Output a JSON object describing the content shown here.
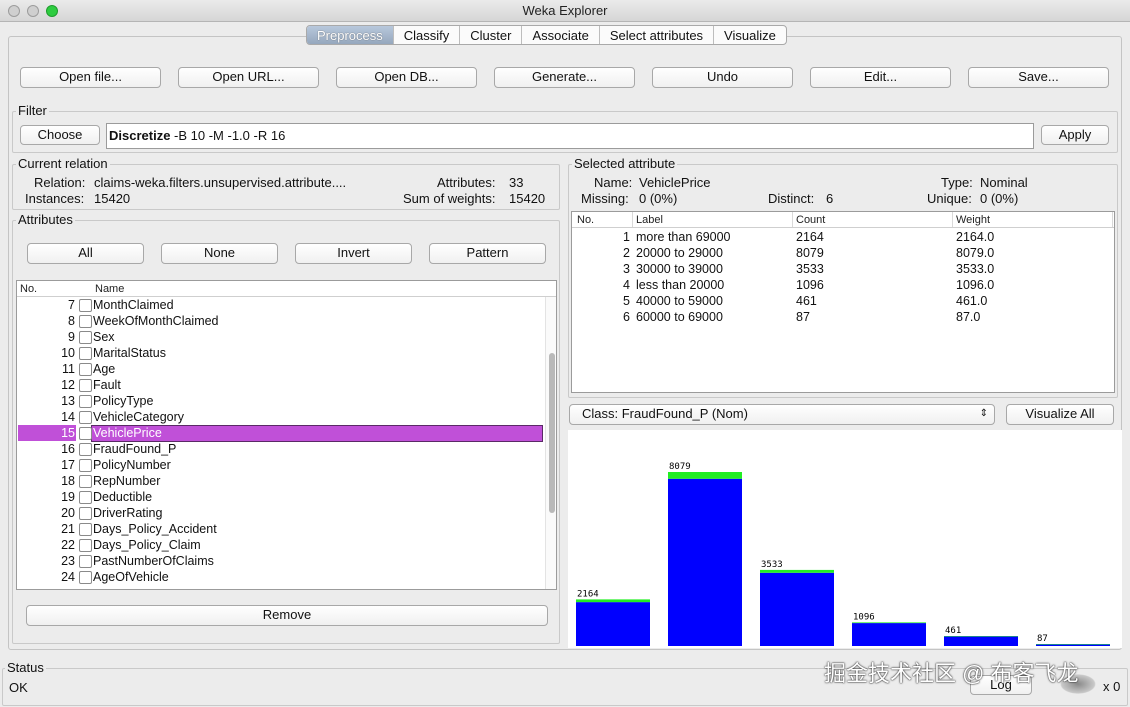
{
  "window": {
    "title": "Weka Explorer"
  },
  "tabs": [
    "Preprocess",
    "Classify",
    "Cluster",
    "Associate",
    "Select attributes",
    "Visualize"
  ],
  "toolbar": {
    "open_file": "Open file...",
    "open_url": "Open URL...",
    "open_db": "Open DB...",
    "generate": "Generate...",
    "undo": "Undo",
    "edit": "Edit...",
    "save": "Save..."
  },
  "filter": {
    "label": "Filter",
    "choose": "Choose",
    "name": "Discretize",
    "options": "-B 10 -M -1.0 -R 16",
    "apply": "Apply"
  },
  "relation": {
    "label": "Current relation",
    "relation_label": "Relation:",
    "relation_value": "claims-weka.filters.unsupervised.attribute....",
    "attributes_label": "Attributes:",
    "attributes_value": "33",
    "instances_label": "Instances:",
    "instances_value": "15420",
    "weights_label": "Sum of weights:",
    "weights_value": "15420"
  },
  "attributes": {
    "label": "Attributes",
    "buttons": {
      "all": "All",
      "none": "None",
      "invert": "Invert",
      "pattern": "Pattern"
    },
    "col_no": "No.",
    "col_name": "Name",
    "rows": [
      {
        "no": "7",
        "name": "MonthClaimed"
      },
      {
        "no": "8",
        "name": "WeekOfMonthClaimed"
      },
      {
        "no": "9",
        "name": "Sex"
      },
      {
        "no": "10",
        "name": "MaritalStatus"
      },
      {
        "no": "11",
        "name": "Age"
      },
      {
        "no": "12",
        "name": "Fault"
      },
      {
        "no": "13",
        "name": "PolicyType"
      },
      {
        "no": "14",
        "name": "VehicleCategory"
      },
      {
        "no": "15",
        "name": "VehiclePrice",
        "selected": true
      },
      {
        "no": "16",
        "name": "FraudFound_P"
      },
      {
        "no": "17",
        "name": "PolicyNumber"
      },
      {
        "no": "18",
        "name": "RepNumber"
      },
      {
        "no": "19",
        "name": "Deductible"
      },
      {
        "no": "20",
        "name": "DriverRating"
      },
      {
        "no": "21",
        "name": "Days_Policy_Accident"
      },
      {
        "no": "22",
        "name": "Days_Policy_Claim"
      },
      {
        "no": "23",
        "name": "PastNumberOfClaims"
      },
      {
        "no": "24",
        "name": "AgeOfVehicle"
      }
    ],
    "remove": "Remove"
  },
  "selected": {
    "label": "Selected attribute",
    "name_label": "Name:",
    "name_value": "VehiclePrice",
    "type_label": "Type:",
    "type_value": "Nominal",
    "missing_label": "Missing:",
    "missing_value": "0 (0%)",
    "distinct_label": "Distinct:",
    "distinct_value": "6",
    "unique_label": "Unique:",
    "unique_value": "0 (0%)",
    "cols": {
      "no": "No.",
      "label": "Label",
      "count": "Count",
      "weight": "Weight"
    },
    "rows": [
      {
        "no": "1",
        "label": "more than 69000",
        "count": "2164",
        "weight": "2164.0"
      },
      {
        "no": "2",
        "label": "20000 to 29000",
        "count": "8079",
        "weight": "8079.0"
      },
      {
        "no": "3",
        "label": "30000 to 39000",
        "count": "3533",
        "weight": "3533.0"
      },
      {
        "no": "4",
        "label": "less than 20000",
        "count": "1096",
        "weight": "1096.0"
      },
      {
        "no": "5",
        "label": "40000 to 59000",
        "count": "461",
        "weight": "461.0"
      },
      {
        "no": "6",
        "label": "60000 to 69000",
        "count": "87",
        "weight": "87.0"
      }
    ]
  },
  "class_select": {
    "value": "Class: FraudFound_P (Nom)",
    "visualize_all": "Visualize All"
  },
  "chart_data": {
    "type": "bar",
    "categories": [
      "more than 69000",
      "20000 to 29000",
      "30000 to 39000",
      "less than 20000",
      "40000 to 59000",
      "60000 to 69000"
    ],
    "values": [
      2164,
      8079,
      3533,
      1096,
      461,
      87
    ],
    "series": [
      {
        "name": "",
        "color": "#0000ff",
        "values": [
          2037,
          7765,
          3399,
          1064,
          448,
          85
        ]
      },
      {
        "name": "",
        "color": "#22ee22",
        "values": [
          127,
          314,
          134,
          32,
          13,
          2
        ]
      }
    ],
    "ylim": [
      0,
      8079
    ]
  },
  "status": {
    "label": "Status",
    "text": "OK",
    "log": "Log",
    "count": "x 0"
  },
  "watermark": "掘金技术社区 @ 布客飞龙"
}
